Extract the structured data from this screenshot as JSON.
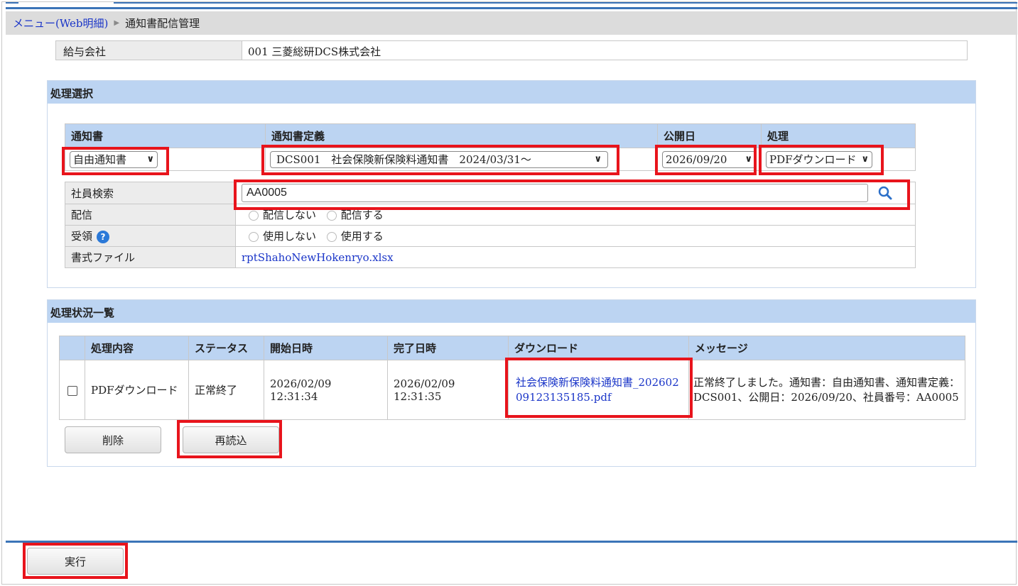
{
  "breadcrumb": {
    "menu": "メニュー(Web明細)",
    "current": "通知書配信管理"
  },
  "company": {
    "label": "給与会社",
    "value": "001 三菱総研DCS株式会社"
  },
  "selection": {
    "title": "処理選択",
    "headers": {
      "notice": "通知書",
      "definition": "通知書定義",
      "publish_date": "公開日",
      "process": "処理"
    },
    "notice_value": "自由通知書",
    "definition_value": "DCS001　社会保険新保険料通知書　2024/03/31～",
    "publish_date_value": "2026/09/20",
    "process_value": "PDFダウンロード",
    "employee_search": {
      "label": "社員検索",
      "value": "AA0005"
    },
    "delivery": {
      "label": "配信",
      "opt1": "配信しない",
      "opt2": "配信する"
    },
    "receipt": {
      "label": "受領",
      "opt1": "使用しない",
      "opt2": "使用する"
    },
    "format_file": {
      "label": "書式ファイル",
      "value": "rptShahoNewHokenryo.xlsx"
    }
  },
  "status": {
    "title": "処理状況一覧",
    "headers": {
      "content": "処理内容",
      "status": "ステータス",
      "start": "開始日時",
      "end": "完了日時",
      "download": "ダウンロード",
      "message": "メッセージ"
    },
    "row": {
      "content": "PDFダウンロード",
      "status": "正常終了",
      "start": "2026/02/09 12:31:34",
      "end": "2026/02/09 12:31:35",
      "download": "社会保険新保険料通知書_20260209123135185.pdf",
      "message": "正常終了しました。通知書：自由通知書、通知書定義：DCS001、公開日：2026/09/20、社員番号：AA0005"
    },
    "delete_label": "削除",
    "reload_label": "再読込"
  },
  "execute_label": "実行"
}
